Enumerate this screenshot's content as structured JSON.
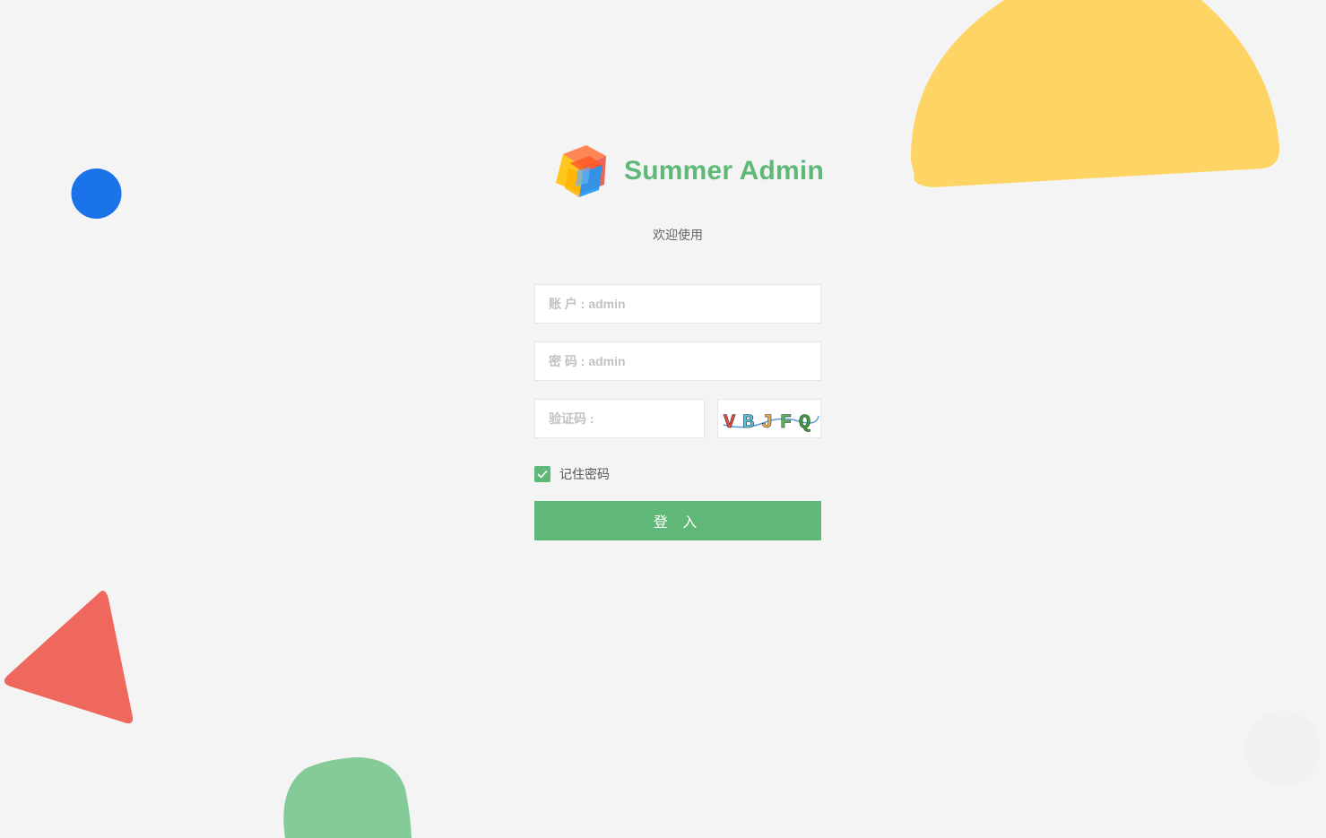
{
  "app": {
    "title": "Summer Admin",
    "welcome": "欢迎使用"
  },
  "form": {
    "account_placeholder": "账 户 : admin",
    "password_placeholder": "密 码 : admin",
    "captcha_placeholder": "验证码 :",
    "captcha_text": "VBJFQ",
    "remember_label": "记住密码",
    "remember_checked": true,
    "login_label": "登 入"
  },
  "colors": {
    "accent": "#5fb878",
    "background": "#f4f4f4",
    "deco_yellow": "#fed564",
    "deco_blue": "#1a73e8",
    "deco_red": "#ee685d",
    "deco_green": "#84cb97",
    "deco_grey": "#eff1f3"
  },
  "icons": {
    "logo": "cube-logo-icon",
    "checkbox": "check-icon"
  }
}
